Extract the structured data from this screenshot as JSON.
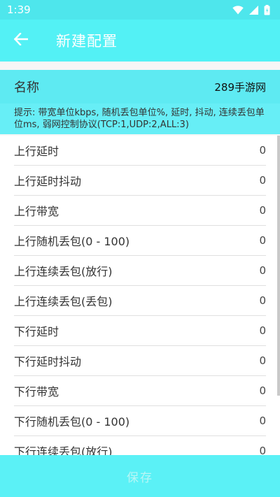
{
  "status_bar": {
    "time": "1:39",
    "icons": [
      "wifi-icon",
      "signal-icon",
      "battery-icon"
    ]
  },
  "app_bar": {
    "back_icon": "arrow-left-icon",
    "title": "新建配置"
  },
  "name_field": {
    "label": "名称",
    "value": "289手游网"
  },
  "hint": "提示: 带宽单位kbps, 随机丢包单位%, 延时, 抖动, 连续丢包单位ms, 弱网控制协议(TCP:1,UDP:2,ALL:3)",
  "settings": [
    {
      "label": "上行延时",
      "value": "0"
    },
    {
      "label": "上行延时抖动",
      "value": "0"
    },
    {
      "label": "上行带宽",
      "value": "0"
    },
    {
      "label": "上行随机丢包(0 - 100)",
      "value": "0"
    },
    {
      "label": "上行连续丢包(放行)",
      "value": "0"
    },
    {
      "label": "上行连续丢包(丢包)",
      "value": "0"
    },
    {
      "label": "下行延时",
      "value": "0"
    },
    {
      "label": "下行延时抖动",
      "value": "0"
    },
    {
      "label": "下行带宽",
      "value": "0"
    },
    {
      "label": "下行随机丢包(0 - 100)",
      "value": "0"
    },
    {
      "label": "下行连续丢包(放行)",
      "value": "0"
    }
  ],
  "save_button": "保存",
  "colors": {
    "status_bar": "#4ee6ec",
    "app_bar": "#53f1f5",
    "name_row": "#5eeaf2",
    "hint_bg": "#67eef6",
    "save_bar": "#5bf1f6"
  }
}
